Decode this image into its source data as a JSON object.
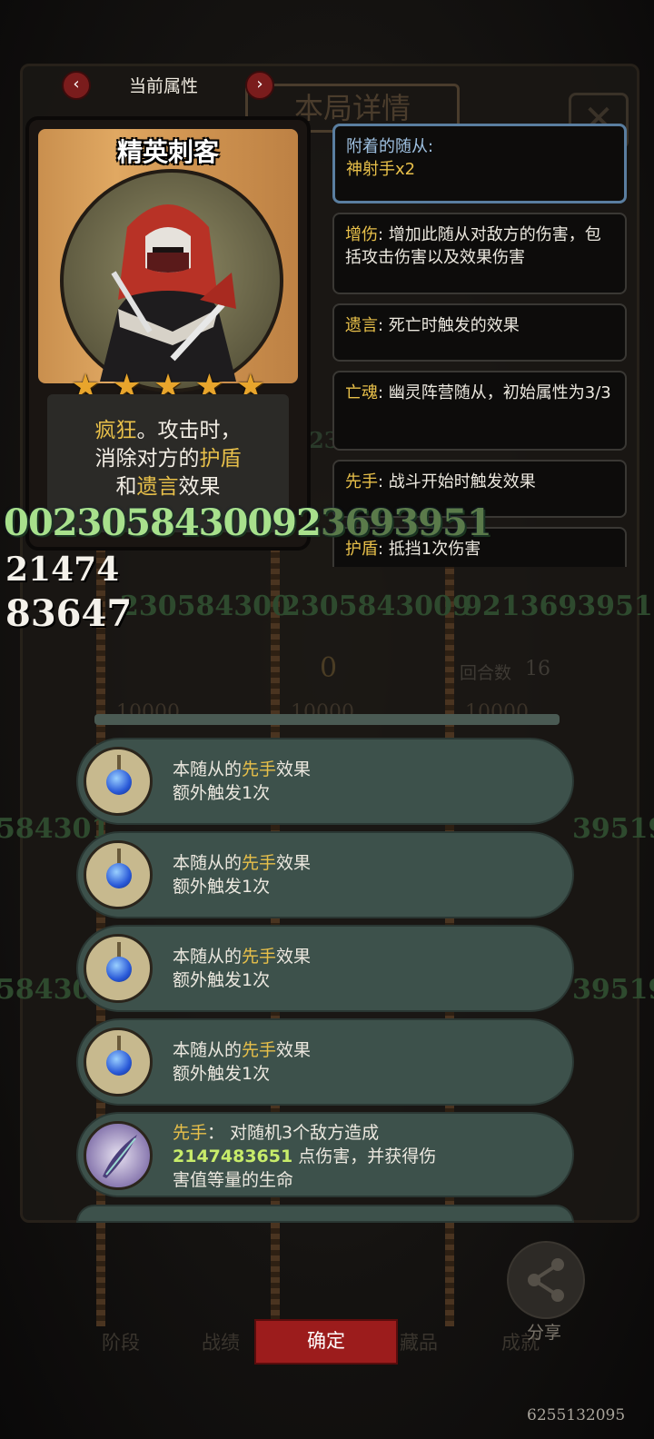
{
  "header": {
    "title": "当前属性",
    "prev_icon": "chevron-left-icon",
    "next_icon": "chevron-right-icon"
  },
  "background": {
    "title_ghost": "本局详情",
    "round_label": "回合数",
    "round_value": "16",
    "center_counter": "0",
    "hp_values": [
      "10000",
      "10000",
      "10000"
    ],
    "tabs": [
      "阶段",
      "战绩",
      "藏品",
      "成就"
    ],
    "ghost_numbers": [
      "2305843009213693951",
      "58430",
      "0.2305843",
      "230584300",
      "2305843009",
      "9213693951",
      "584301",
      "39519",
      "58430",
      "39519"
    ]
  },
  "card": {
    "name": "精英刺客",
    "stars": 5,
    "desc": {
      "kw1": "疯狂",
      "t1": "。攻击时，",
      "t2a": "消除对方的",
      "kw2": "护盾",
      "t3a": "和",
      "kw3": "遗言",
      "t3b": "效果"
    }
  },
  "keywords": [
    {
      "k": "附着的随从:",
      "text": "神射手x2"
    },
    {
      "k": "增伤",
      "text": ": 增加此随从对敌方的伤害，包括攻击伤害以及效果伤害"
    },
    {
      "k": "遗言",
      "text": ": 死亡时触发的效果"
    },
    {
      "k": "亡魂",
      "text": ": 幽灵阵营随从，初始属性为3/3"
    },
    {
      "k": "先手",
      "text": ": 战斗开始时触发效果"
    },
    {
      "k": "护盾",
      "text": ": 抵挡1次伤害"
    }
  ],
  "overlay_numbers": {
    "green": "0023058430092",
    "green_tail": "3693951",
    "white1": "21474",
    "white2": "83647"
  },
  "effects": [
    {
      "prefix": "本随从的",
      "keyword": "先手",
      "suffix": "效果",
      "line2": "额外触发1次"
    },
    {
      "prefix": "本随从的",
      "keyword": "先手",
      "suffix": "效果",
      "line2": "额外触发1次"
    },
    {
      "prefix": "本随从的",
      "keyword": "先手",
      "suffix": "效果",
      "line2": "额外触发1次"
    },
    {
      "prefix": "本随从的",
      "keyword": "先手",
      "suffix": "效果",
      "line2": "额外触发1次"
    }
  ],
  "special_effect": {
    "keyword": "先手",
    "line1": "： 对随机3个敌方造成",
    "number": "2147483651",
    "line2": " 点伤害，并获得伤",
    "line3": "害值等量的生命"
  },
  "bottom": {
    "confirm": "确定",
    "share": "分享",
    "share_icon": "share-icon",
    "id": "6255132095"
  }
}
